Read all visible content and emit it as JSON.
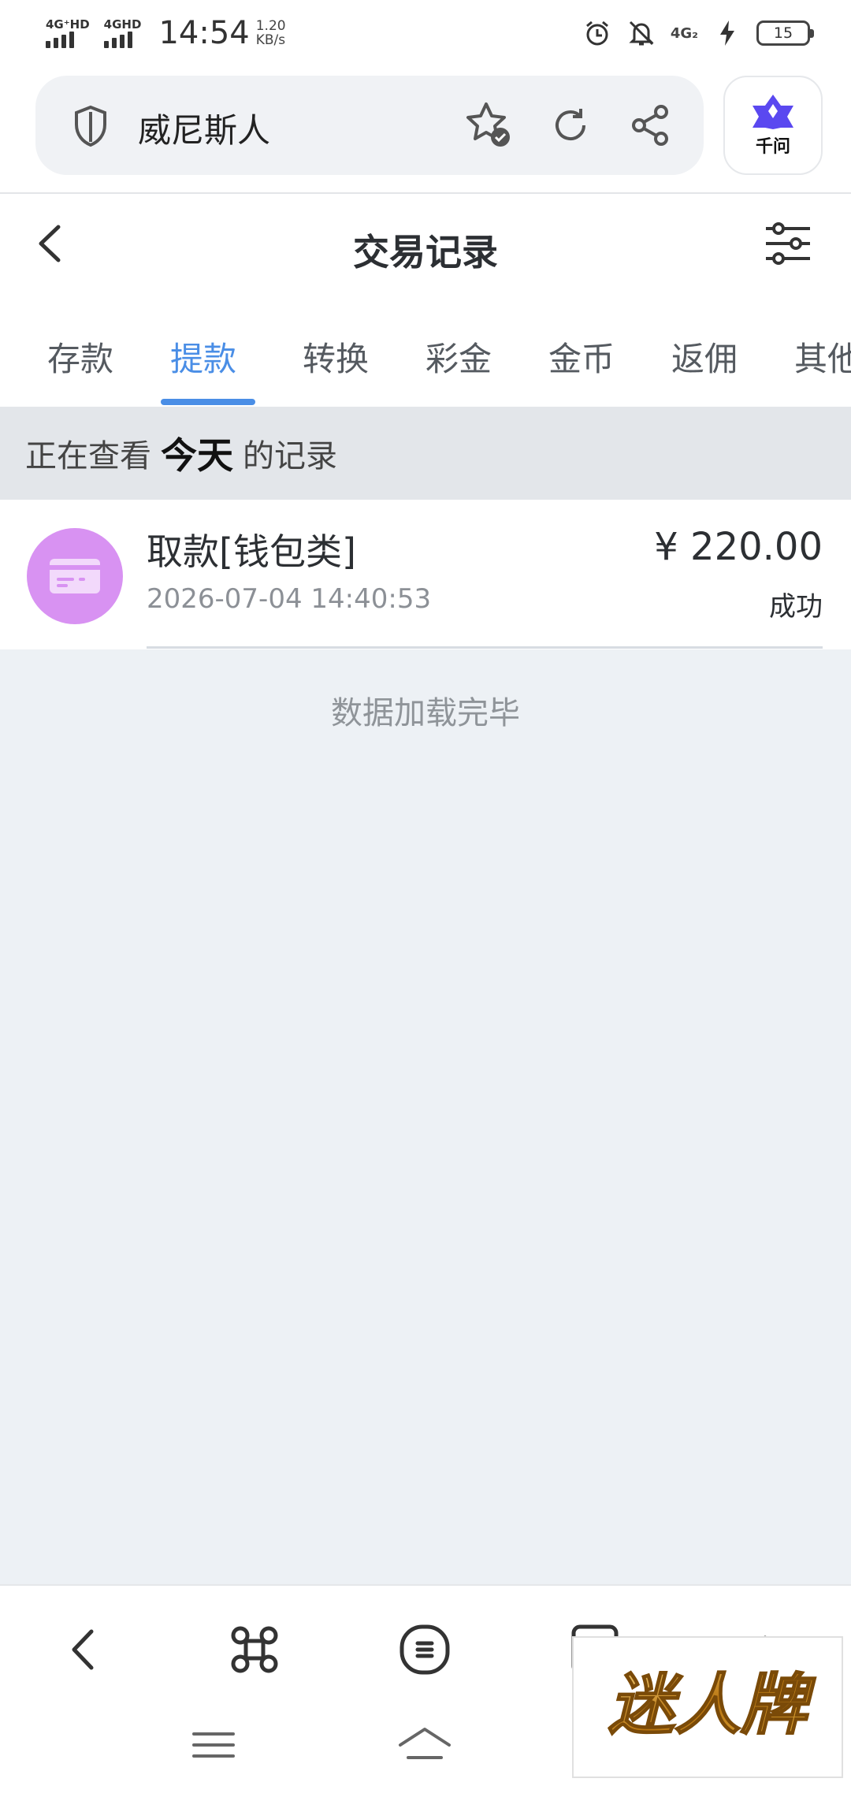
{
  "status_bar": {
    "signal_1_label": "4G⁺HD",
    "signal_2_label": "4GHD",
    "time": "14:54",
    "net_speed_value": "1.20",
    "net_speed_unit": "KB/s",
    "network_2": "4G₂",
    "battery": "15"
  },
  "browser": {
    "url_text": "威尼斯人",
    "assistant_label": "千问"
  },
  "header": {
    "title": "交易记录"
  },
  "tabs": [
    {
      "label": "存款"
    },
    {
      "label": "提款"
    },
    {
      "label": "转换"
    },
    {
      "label": "彩金"
    },
    {
      "label": "金币"
    },
    {
      "label": "返佣"
    },
    {
      "label": "其他"
    }
  ],
  "viewing": {
    "prefix": "正在查看",
    "period": "今天",
    "suffix": "的记录"
  },
  "records": [
    {
      "type": "取款[钱包类]",
      "datetime": "2026-07-04 14:40:53",
      "amount": "¥ 220.00",
      "status": "成功"
    }
  ],
  "footer_message": "数据加载完毕",
  "watermark_text": "迷人牌",
  "colors": {
    "accent": "#4a8ee6",
    "record_icon_bg": "#d892f2",
    "page_bg": "#edf1f5",
    "viewing_bar_bg": "#e3e6ea"
  }
}
